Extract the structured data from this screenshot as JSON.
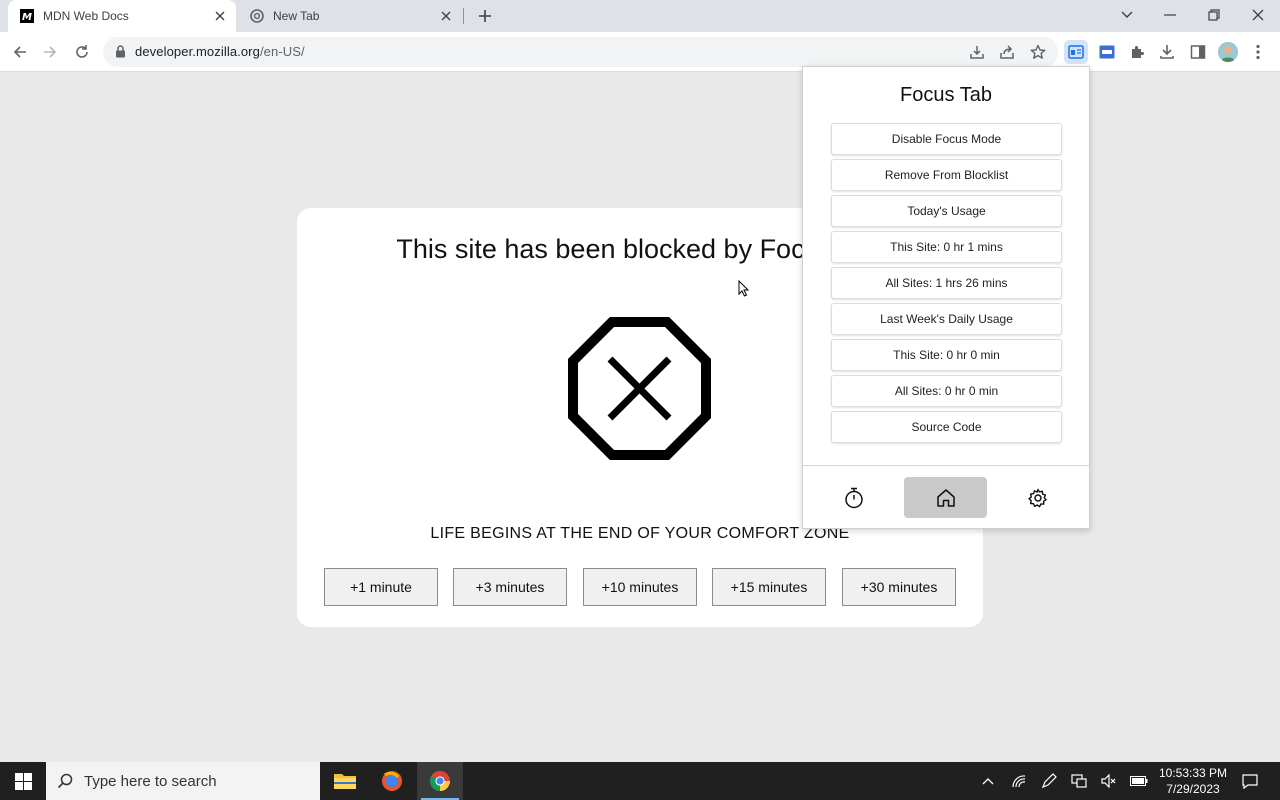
{
  "browser": {
    "tabs": [
      {
        "title": "MDN Web Docs",
        "active": true
      },
      {
        "title": "New Tab",
        "active": false
      }
    ],
    "url_host": "developer.mozilla.org",
    "url_path": "/en-US/"
  },
  "page": {
    "heading": "This site has been blocked by Focus Tab",
    "quote": "LIFE BEGINS AT THE END OF YOUR COMFORT ZONE",
    "time_buttons": [
      "+1 minute",
      "+3 minutes",
      "+10 minutes",
      "+15 minutes",
      "+30 minutes"
    ]
  },
  "popup": {
    "title": "Focus Tab",
    "buttons": [
      "Disable Focus Mode",
      "Remove From Blocklist",
      "Today's Usage",
      "This Site: 0 hr 1 mins",
      "All Sites: 1 hrs 26 mins",
      "Last Week's Daily Usage",
      "This Site: 0 hr 0 min",
      "All Sites: 0 hr 0 min",
      "Source Code"
    ],
    "footer_icons": [
      "timer-icon",
      "home-icon",
      "settings-icon"
    ],
    "active_footer": "home-icon"
  },
  "taskbar": {
    "search_placeholder": "Type here to search",
    "time": "10:53:33 PM",
    "date": "7/29/2023"
  },
  "colors": {
    "page_bg": "#e9e9e9",
    "tabstrip_bg": "#dee1e6",
    "taskbar_bg": "#202020",
    "popup_active_nav": "#c9c9c9"
  }
}
